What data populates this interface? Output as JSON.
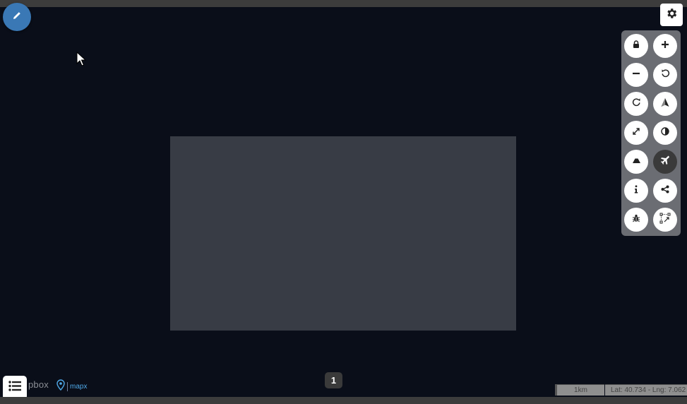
{
  "map": {
    "attribution": "pbox",
    "brand": "mapx",
    "page_number": "1",
    "scale_label": "1km",
    "coords_text": "Lat: 40.734 - Lng: 7.062"
  },
  "toolbar": {
    "buttons": [
      {
        "name": "lock-button",
        "icon": "lock-icon"
      },
      {
        "name": "zoom-in-button",
        "icon": "plus-icon"
      },
      {
        "name": "zoom-out-button",
        "icon": "minus-icon"
      },
      {
        "name": "rotate-left-button",
        "icon": "rotate-ccw-icon"
      },
      {
        "name": "rotate-right-button",
        "icon": "rotate-cw-icon"
      },
      {
        "name": "north-arrow-button",
        "icon": "compass-arrow-icon"
      },
      {
        "name": "fullscreen-button",
        "icon": "expand-icon"
      },
      {
        "name": "theme-toggle-button",
        "icon": "contrast-icon"
      },
      {
        "name": "terrain-button",
        "icon": "mountain-icon"
      },
      {
        "name": "fly-button",
        "icon": "airplane-icon",
        "active": true
      },
      {
        "name": "info-button",
        "icon": "info-icon"
      },
      {
        "name": "share-button",
        "icon": "share-icon"
      },
      {
        "name": "debug-button",
        "icon": "bug-icon"
      },
      {
        "name": "bbox-button",
        "icon": "bbox-icon"
      }
    ]
  },
  "colors": {
    "background": "#0a0e19",
    "overlay": "#383c45",
    "accent": "#3a78b5",
    "panel": "#6b6d73"
  }
}
